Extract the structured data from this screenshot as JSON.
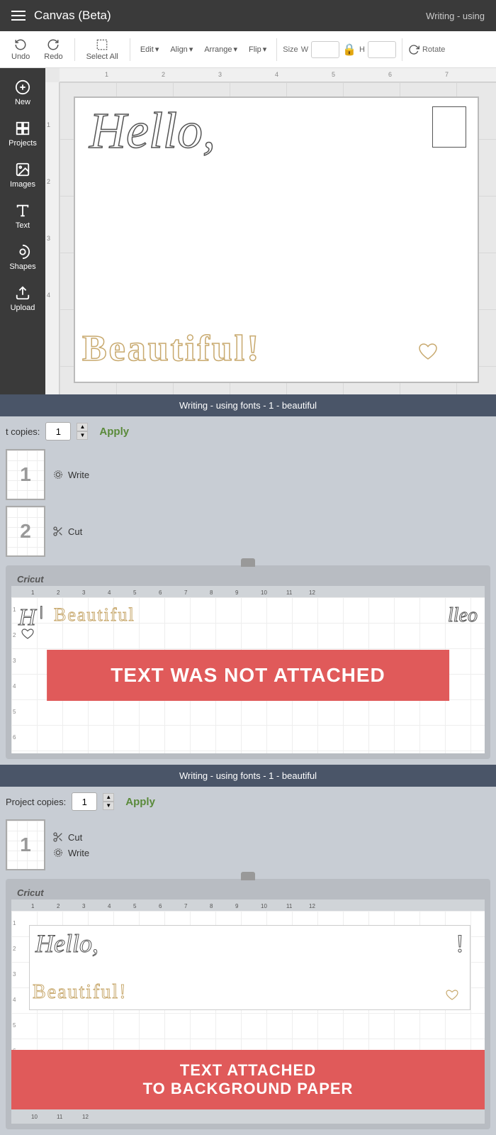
{
  "app": {
    "title": "Canvas (Beta)",
    "status_right": "Writing - using"
  },
  "toolbar": {
    "undo": "Undo",
    "redo": "Redo",
    "select_all": "Select All",
    "edit": "Edit",
    "align": "Align",
    "arrange": "Arrange",
    "flip": "Flip",
    "size_label": "Size",
    "size_w": "W",
    "size_h": "H",
    "rotate": "Rotate"
  },
  "sidebar": {
    "items": [
      {
        "label": "New",
        "icon": "plus-icon"
      },
      {
        "label": "Projects",
        "icon": "projects-icon"
      },
      {
        "label": "Images",
        "icon": "images-icon"
      },
      {
        "label": "Text",
        "icon": "text-icon"
      },
      {
        "label": "Shapes",
        "icon": "shapes-icon"
      },
      {
        "label": "Upload",
        "icon": "upload-icon"
      }
    ]
  },
  "canvas": {
    "ruler_marks_top": [
      "1",
      "2",
      "3",
      "4",
      "5",
      "6",
      "7"
    ],
    "ruler_marks_left": [
      "1",
      "2",
      "3",
      "4"
    ]
  },
  "status_bar_1": {
    "text": "Writing - using fonts - 1 - beautiful"
  },
  "mat_section_1": {
    "copies_label": "t copies:",
    "copies_value": "1",
    "apply_label": "Apply",
    "mat1": {
      "number": "1",
      "action": "Write"
    },
    "mat2": {
      "number": "2",
      "action": "Cut"
    },
    "cricut_label": "Cricut",
    "overlay_text": "TEXT WAS NOT ATTACHED"
  },
  "status_bar_2": {
    "text": "Writing - using fonts - 1 - beautiful"
  },
  "mat_section_2": {
    "copies_label": "Project copies:",
    "copies_value": "1",
    "apply_label": "Apply",
    "mat1": {
      "number": "1",
      "actions": [
        "Cut",
        "Write"
      ]
    },
    "cricut_label": "Cricut",
    "overlay_text": "TEXT ATTACHED\nTO BACKGROUND PAPER"
  }
}
